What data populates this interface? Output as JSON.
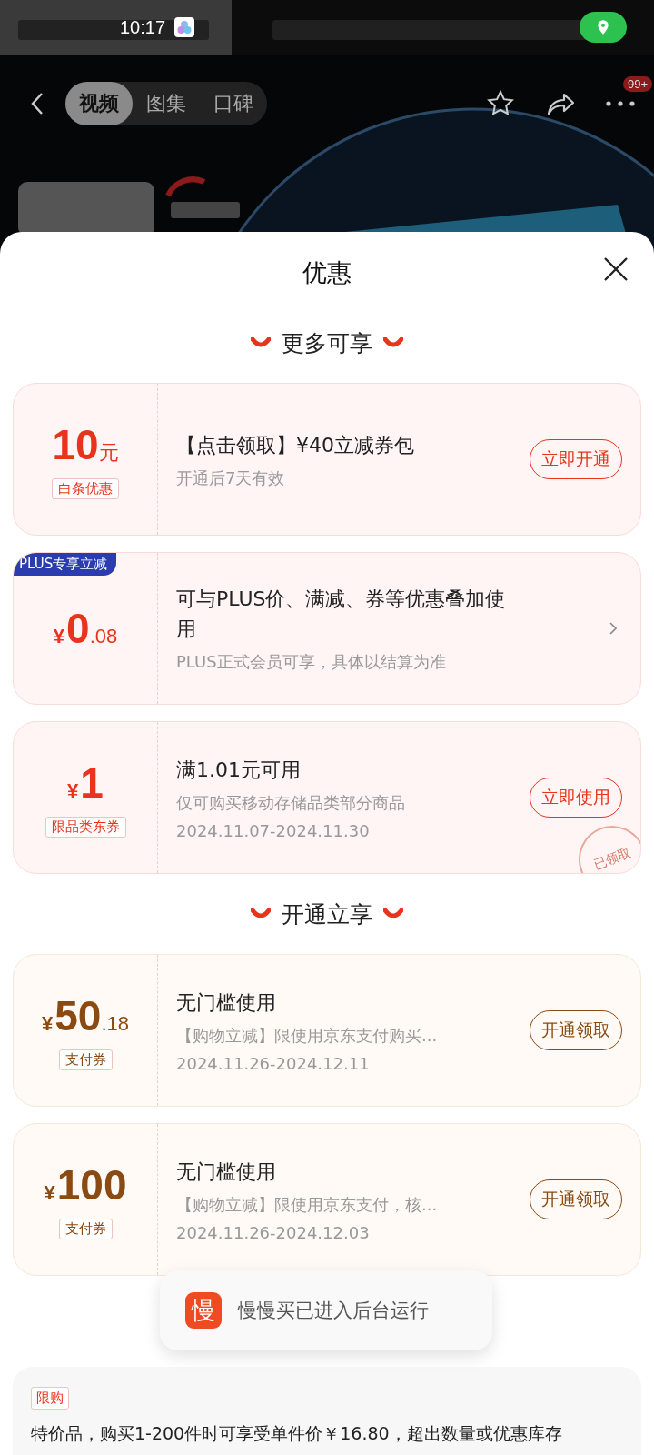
{
  "status_bar": {
    "time": "10:17"
  },
  "nav": {
    "tabs": [
      {
        "label": "视频",
        "selected": true
      },
      {
        "label": "图集",
        "selected": false
      },
      {
        "label": "口碑",
        "selected": false
      }
    ],
    "badge": "99+"
  },
  "sheet": {
    "title": "优惠",
    "sections": [
      {
        "title": "更多可享",
        "kind": "red",
        "coupons": [
          {
            "main": "10",
            "suffix": "元",
            "tag": "白条优惠",
            "title": "【点击领取】¥40立减券包",
            "lines": [
              "开通后7天有效"
            ],
            "action": {
              "kind": "button",
              "label": "立即开通"
            }
          },
          {
            "corner": "PLUS专享立减",
            "prefix": "¥",
            "main": "0",
            "suffix": ".08",
            "title": "可与PLUS价、满减、券等优惠叠加使用",
            "lines": [
              "PLUS正式会员可享，具体以结算为准"
            ],
            "action": {
              "kind": "chevron"
            }
          },
          {
            "prefix": "¥",
            "main": "1",
            "tag": "限品类东券",
            "title": "满1.01元可用",
            "lines": [
              "仅可购买移动存储品类部分商品",
              "2024.11.07-2024.11.30"
            ],
            "action": {
              "kind": "button",
              "label": "立即使用"
            },
            "stamp": "已领取"
          }
        ]
      },
      {
        "title": "开通立享",
        "kind": "brown",
        "coupons": [
          {
            "prefix": "¥",
            "main": "50",
            "suffix": ".18",
            "tag": "支付券",
            "title": "无门槛使用",
            "lines": [
              "【购物立减】限使用京东支付购买...",
              "2024.11.26-2024.12.11"
            ],
            "action": {
              "kind": "button",
              "label": "开通领取"
            }
          },
          {
            "prefix": "¥",
            "main": "100",
            "tag": "支付券",
            "title": "无门槛使用",
            "lines": [
              "【购物立减】限使用京东支付，核...",
              "2024.11.26-2024.12.03"
            ],
            "action": {
              "kind": "button",
              "label": "开通领取"
            }
          }
        ]
      }
    ],
    "limit": {
      "tag": "限购",
      "text": "特价品，购买1-200件时可享受单件价￥16.80，超出数量或优惠库存"
    }
  },
  "toast": {
    "icon_text": "慢",
    "text": "慢慢买已进入后台运行"
  }
}
